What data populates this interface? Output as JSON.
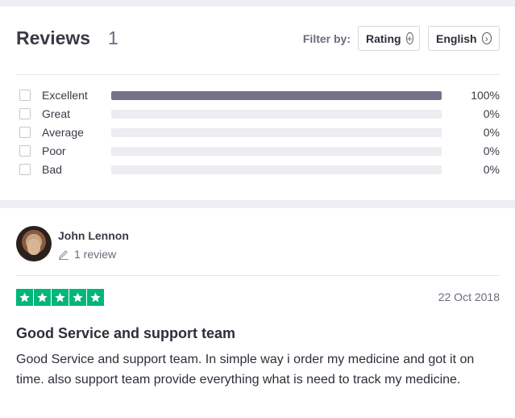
{
  "header": {
    "title": "Reviews",
    "count": "1",
    "filter_label": "Filter by:",
    "filter_rating": "Rating",
    "filter_language": "English"
  },
  "ratings": [
    {
      "label": "Excellent",
      "percent_text": "100%",
      "percent": 100
    },
    {
      "label": "Great",
      "percent_text": "0%",
      "percent": 0
    },
    {
      "label": "Average",
      "percent_text": "0%",
      "percent": 0
    },
    {
      "label": "Poor",
      "percent_text": "0%",
      "percent": 0
    },
    {
      "label": "Bad",
      "percent_text": "0%",
      "percent": 0
    }
  ],
  "review": {
    "author": "John Lennon",
    "review_count": "1 review",
    "stars": 5,
    "date": "22 Oct 2018",
    "title": "Good Service and support team",
    "body": "Good Service and support team. In simple way i order my medicine and got it on time. also support team provide everything what is need to track my medicine."
  },
  "colors": {
    "bar_fill": "#73738c",
    "bar_track": "#ececf1",
    "star_green": "#00b67a",
    "page_bg": "#efeff3"
  },
  "icons": {
    "rating_filter": "plus-circle-icon",
    "language_filter": "chevron-right-circle-icon",
    "review_count": "pencil-icon",
    "star": "star-icon"
  }
}
